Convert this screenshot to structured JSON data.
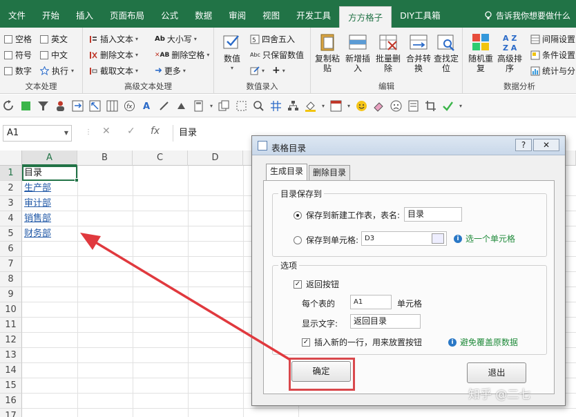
{
  "ribbon": {
    "tabs": [
      "文件",
      "开始",
      "插入",
      "页面布局",
      "公式",
      "数据",
      "审阅",
      "视图",
      "开发工具",
      "方方格子",
      "DIY工具箱"
    ],
    "active_tab": "方方格子",
    "tell_me": "告诉我你想要做什么",
    "groups": {
      "text_processing": {
        "label": "文本处理",
        "checks": [
          "空格",
          "英文",
          "符号",
          "中文",
          "数字"
        ],
        "execute": "执行"
      },
      "advanced_text": {
        "label": "高级文本处理",
        "insert_text": "插入文本",
        "delete_text": "删除文本",
        "extract_text": "截取文本",
        "case": "大小写",
        "delete_spaces": "删除空格",
        "more": "更多"
      },
      "numeric_entry": {
        "label": "数值录入",
        "numeric": "数值",
        "round": "四舍五入",
        "keep_numeric": "只保留数值"
      },
      "edit": {
        "label": "编辑",
        "buttons": [
          "复制粘贴",
          "新增插入",
          "批量删除",
          "合并转换",
          "查找定位"
        ]
      },
      "analysis": {
        "label": "数据分析",
        "buttons": [
          "随机重复",
          "高级排序"
        ],
        "side": [
          "间隔设置",
          "条件设置",
          "统计与分"
        ]
      }
    }
  },
  "formula_bar": {
    "name_box": "A1",
    "formula": "目录"
  },
  "grid": {
    "columns": [
      "A",
      "B",
      "C",
      "D"
    ],
    "rows": [
      "1",
      "2",
      "3",
      "4",
      "5",
      "6",
      "7",
      "8",
      "9",
      "10",
      "11",
      "12",
      "13",
      "14",
      "15",
      "16",
      "17"
    ],
    "cells": [
      "目录",
      "生产部",
      "审计部",
      "销售部",
      "财务部"
    ]
  },
  "dialog": {
    "title": "表格目录",
    "help": "?",
    "close": "✕",
    "tabs": [
      "生成目录",
      "删除目录"
    ],
    "save_section": {
      "legend": "目录保存到",
      "option_new_sheet": "保存到新建工作表，表名:",
      "new_sheet_name": "目录",
      "option_cell": "保存到单元格:",
      "cell_value": "D3",
      "pick_cell_hint": "选一个单元格"
    },
    "options_section": {
      "legend": "选项",
      "back_button": "返回按钮",
      "per_table_label": "每个表的",
      "per_table_cell": "A1",
      "cell_suffix": "单元格",
      "display_text_label": "显示文字:",
      "display_text": "返回目录",
      "insert_row": "插入新的一行，用来放置按钮",
      "insert_row_hint": "避免覆盖原数据"
    },
    "ok": "确定",
    "exit": "退出"
  },
  "watermark": "知乎 @二七",
  "colors": {
    "excel_green": "#217346",
    "highlight_red": "#d9484c",
    "link_blue": "#1f57a6"
  }
}
